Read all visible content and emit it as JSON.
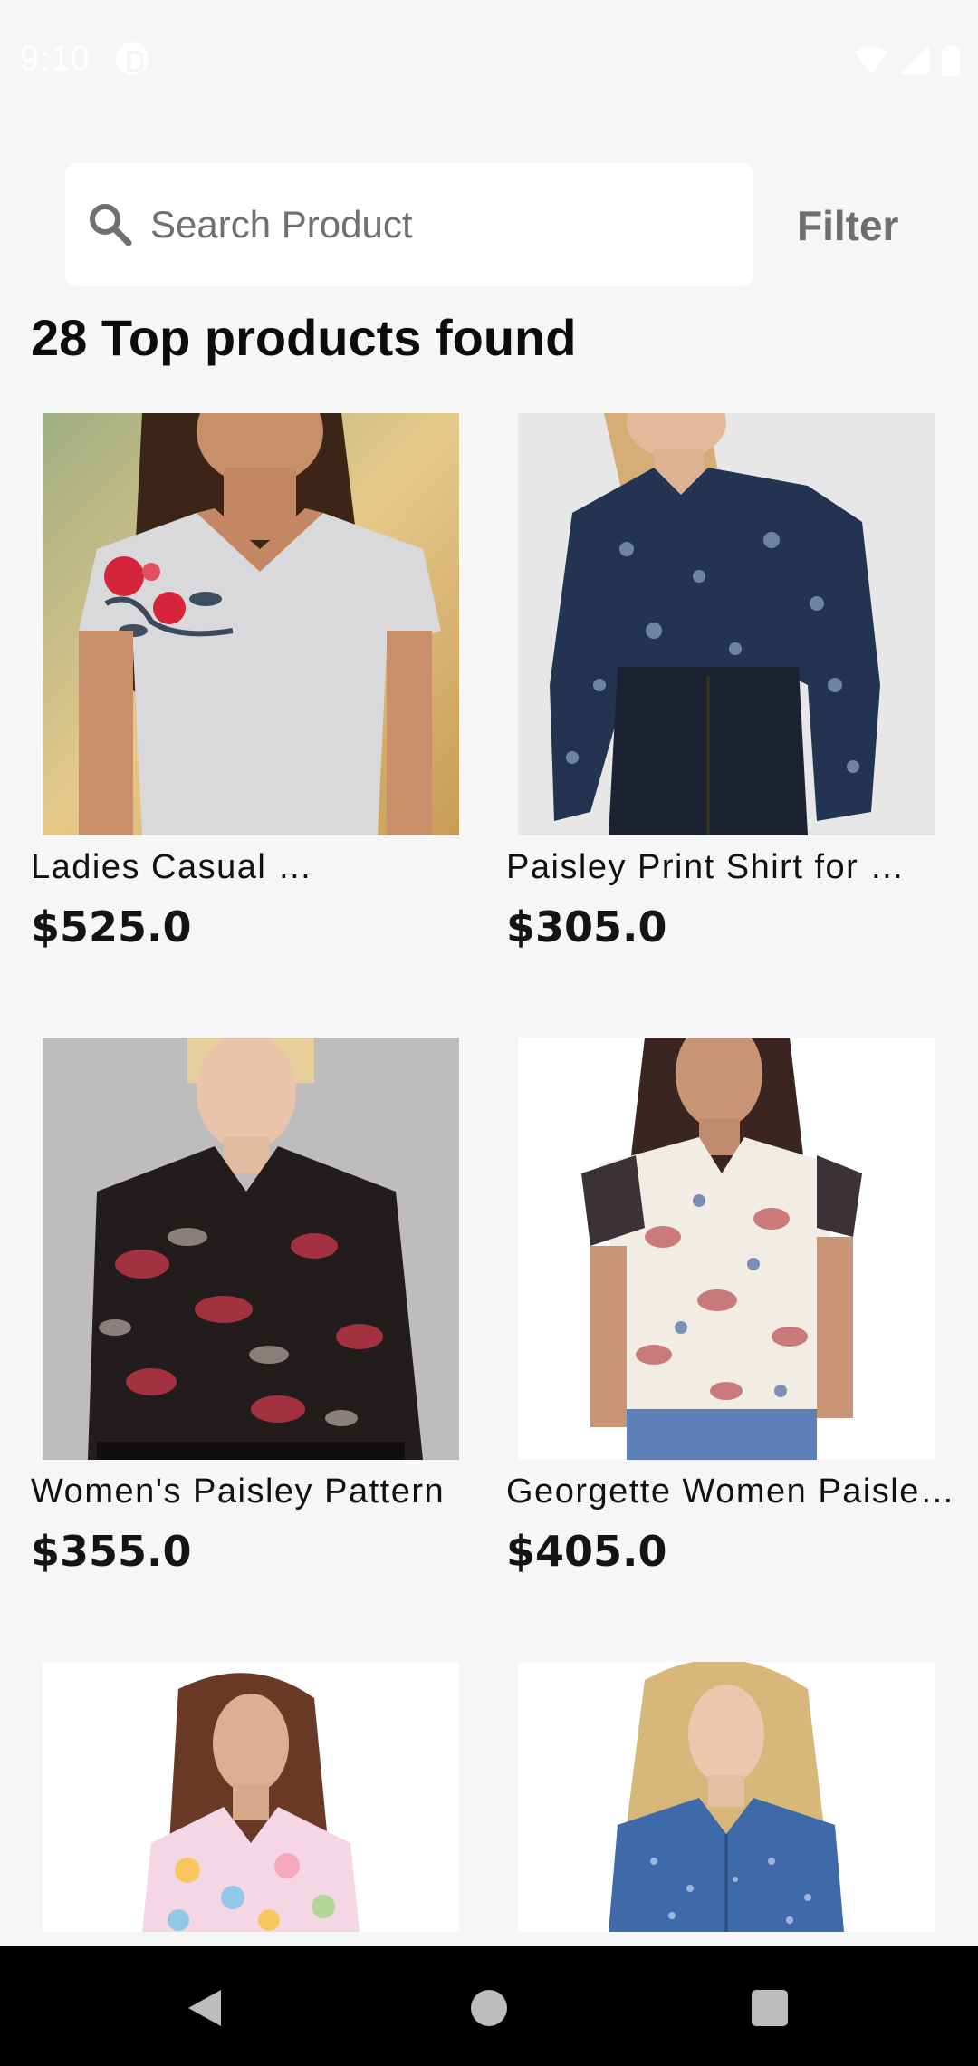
{
  "status_bar": {
    "time": "9:10"
  },
  "search": {
    "placeholder": "Search Product",
    "value": ""
  },
  "filter_label": "Filter",
  "results_title": "28 Top products found",
  "products": [
    {
      "title": "Ladies Casual …",
      "price": "$525.0",
      "image": "woman-in-embroidered-floral-tshirt"
    },
    {
      "title": "Paisley Print Shirt for …",
      "price": "$305.0",
      "image": "woman-in-navy-paisley-blouse"
    },
    {
      "title": "Women's Paisley Pattern",
      "price": "$355.0",
      "image": "woman-in-dark-paisley-shirt"
    },
    {
      "title": "Georgette Women Paisle…",
      "price": "$405.0",
      "image": "woman-in-white-paisley-top"
    },
    {
      "title": "",
      "price": "",
      "image": "woman-in-pastel-floral-shirt"
    },
    {
      "title": "",
      "price": "",
      "image": "woman-in-blue-print-shirt"
    }
  ],
  "colors": {
    "background": "#f6f6f6",
    "card_surface": "#ffffff",
    "filter_text": "#6e6e6e",
    "nav_bar": "#000000"
  }
}
